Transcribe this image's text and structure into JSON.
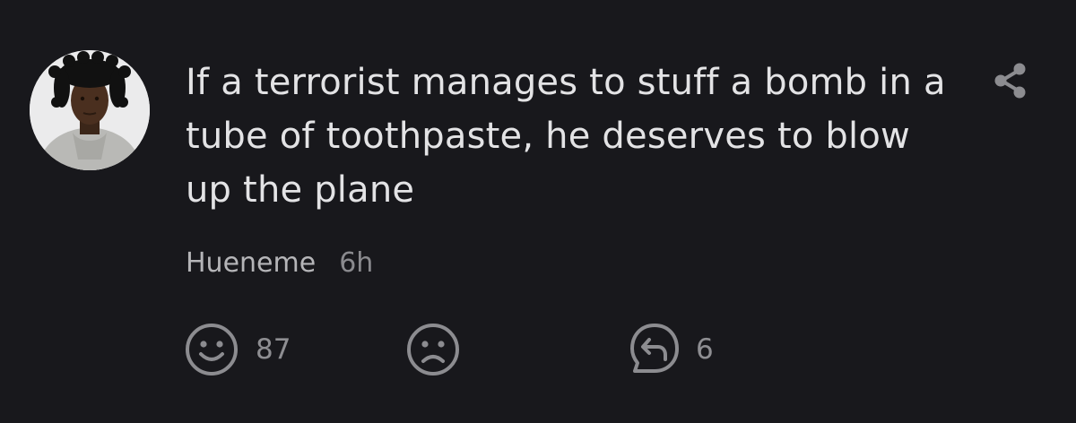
{
  "post": {
    "text": "If a terrorist manages to stuff a bomb in a tube of toothpaste, he deserves to blow up the plane",
    "author": "Hueneme",
    "time": "6h"
  },
  "actions": {
    "like_count": "87",
    "reply_count": "6"
  },
  "icons": {
    "share": "share-icon",
    "like": "smile-icon",
    "dislike": "frown-icon",
    "reply": "reply-bubble-icon"
  },
  "colors": {
    "background": "#18181c",
    "text": "#e3e3e5",
    "meta": "#8a8a8e"
  }
}
